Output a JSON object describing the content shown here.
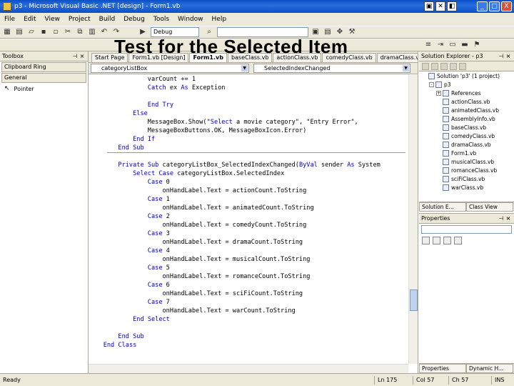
{
  "window": {
    "title": "p3 - Microsoft Visual Basic .NET [design] - Form1.vb",
    "controls": [
      "_",
      "□",
      "X"
    ]
  },
  "menu": [
    "File",
    "Edit",
    "View",
    "Project",
    "Build",
    "Debug",
    "Tools",
    "Window",
    "Help"
  ],
  "toolbar": {
    "config_combo": "Debug",
    "search_combo": ""
  },
  "slide_title": "Test for the Selected Item",
  "toolbox": {
    "title": "Toolbox",
    "tab_clipboard": "Clipboard Ring",
    "tab_general": "General",
    "item_pointer": "Pointer"
  },
  "editor": {
    "tabs": [
      "Start Page",
      "Form1.vb [Design]",
      "Form1.vb",
      "baseClass.vb",
      "actionClass.vb",
      "comedyClass.vb",
      "dramaClass.vb"
    ],
    "active_tab_index": 2,
    "object_combo": "categoryListBox",
    "event_combo": "SelectedIndexChanged",
    "lines": [
      {
        "indent": "            ",
        "text": "varCount += 1",
        "type": "code"
      },
      {
        "indent": "            ",
        "text": "Catch ex As Exception",
        "type": "code"
      },
      {
        "indent": "",
        "text": "",
        "type": "code"
      },
      {
        "indent": "            ",
        "text": "End Try",
        "type": "code"
      },
      {
        "indent": "        ",
        "text": "Else",
        "type": "code"
      },
      {
        "indent": "            ",
        "text": "MessageBox.Show(\"Select a movie category\", \"Entry Error\",",
        "type": "code"
      },
      {
        "indent": "            ",
        "text": "MessageBoxButtons.OK, MessageBoxIcon.Error)",
        "type": "code"
      },
      {
        "indent": "        ",
        "text": "End If",
        "type": "code"
      },
      {
        "indent": "    ",
        "text": "End Sub",
        "type": "code"
      },
      {
        "indent": "",
        "text": "",
        "type": "sep"
      },
      {
        "indent": "    ",
        "text": "Private Sub categoryListBox_SelectedIndexChanged(ByVal sender As System",
        "type": "code"
      },
      {
        "indent": "        ",
        "text": "Select Case categoryListBox.SelectedIndex",
        "type": "code"
      },
      {
        "indent": "            ",
        "text": "Case 0",
        "type": "code"
      },
      {
        "indent": "                ",
        "text": "onHandLabel.Text = actionCount.ToString",
        "type": "code"
      },
      {
        "indent": "            ",
        "text": "Case 1",
        "type": "code"
      },
      {
        "indent": "                ",
        "text": "onHandLabel.Text = animatedCount.ToString",
        "type": "code"
      },
      {
        "indent": "            ",
        "text": "Case 2",
        "type": "code"
      },
      {
        "indent": "                ",
        "text": "onHandLabel.Text = comedyCount.ToString",
        "type": "code"
      },
      {
        "indent": "            ",
        "text": "Case 3",
        "type": "code"
      },
      {
        "indent": "                ",
        "text": "onHandLabel.Text = dramaCount.ToString",
        "type": "code"
      },
      {
        "indent": "            ",
        "text": "Case 4",
        "type": "code"
      },
      {
        "indent": "                ",
        "text": "onHandLabel.Text = musicalCount.ToString",
        "type": "code"
      },
      {
        "indent": "            ",
        "text": "Case 5",
        "type": "code"
      },
      {
        "indent": "                ",
        "text": "onHandLabel.Text = romanceCount.ToString",
        "type": "code"
      },
      {
        "indent": "            ",
        "text": "Case 6",
        "type": "code"
      },
      {
        "indent": "                ",
        "text": "onHandLabel.Text = sciFiCount.ToString",
        "type": "code"
      },
      {
        "indent": "            ",
        "text": "Case 7",
        "type": "code"
      },
      {
        "indent": "                ",
        "text": "onHandLabel.Text = warCount.ToString",
        "type": "code"
      },
      {
        "indent": "        ",
        "text": "End Select",
        "type": "code"
      },
      {
        "indent": "",
        "text": "",
        "type": "code"
      },
      {
        "indent": "    ",
        "text": "End Sub",
        "type": "code"
      },
      {
        "indent": "",
        "text": "End Class",
        "type": "code"
      }
    ]
  },
  "solution_explorer": {
    "title": "Solution Explorer - p3",
    "items": [
      {
        "label": "Solution 'p3' (1 project)",
        "level": 0,
        "expander": ""
      },
      {
        "label": "p3",
        "level": 1,
        "expander": "-"
      },
      {
        "label": "References",
        "level": 2,
        "expander": "+"
      },
      {
        "label": "actionClass.vb",
        "level": 2,
        "expander": ""
      },
      {
        "label": "animatedClass.vb",
        "level": 2,
        "expander": ""
      },
      {
        "label": "AssemblyInfo.vb",
        "level": 2,
        "expander": ""
      },
      {
        "label": "baseClass.vb",
        "level": 2,
        "expander": ""
      },
      {
        "label": "comedyClass.vb",
        "level": 2,
        "expander": ""
      },
      {
        "label": "dramaClass.vb",
        "level": 2,
        "expander": ""
      },
      {
        "label": "Form1.vb",
        "level": 2,
        "expander": ""
      },
      {
        "label": "musicalClass.vb",
        "level": 2,
        "expander": ""
      },
      {
        "label": "romanceClass.vb",
        "level": 2,
        "expander": ""
      },
      {
        "label": "sciFiClass.vb",
        "level": 2,
        "expander": ""
      },
      {
        "label": "warClass.vb",
        "level": 2,
        "expander": ""
      }
    ],
    "bottom_tabs": [
      "Solution E...",
      "Class View"
    ]
  },
  "properties": {
    "title": "Properties",
    "bottom_tabs": [
      "Properties",
      "Dynamic H..."
    ]
  },
  "status": {
    "ready": "Ready",
    "line": "Ln 175",
    "col": "Col 57",
    "ch": "Ch 57",
    "mode": "INS"
  }
}
